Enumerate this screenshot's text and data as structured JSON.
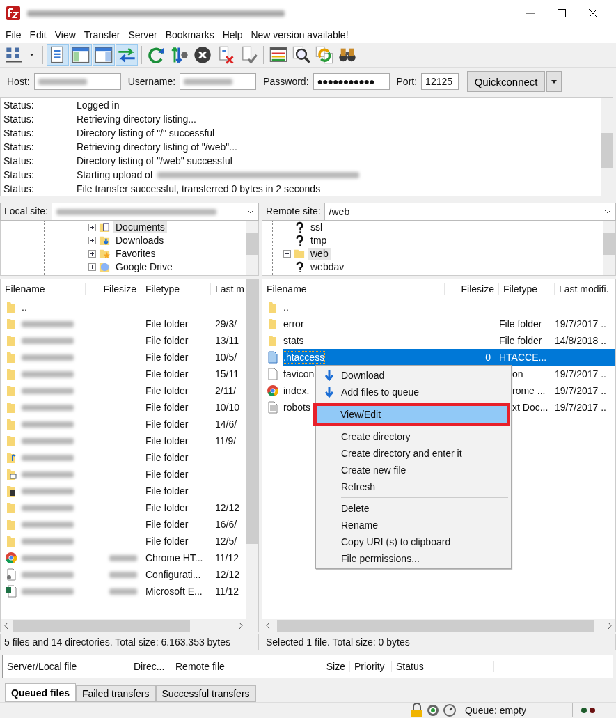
{
  "menu": [
    "File",
    "Edit",
    "View",
    "Transfer",
    "Server",
    "Bookmarks",
    "Help",
    "New version available!"
  ],
  "quickconnect": {
    "host_label": "Host:",
    "username_label": "Username:",
    "password_label": "Password:",
    "password_value": "●●●●●●●●●●●",
    "port_label": "Port:",
    "port_value": "12125",
    "button": "Quickconnect"
  },
  "log": [
    {
      "label": "Status:",
      "message": "Logged in"
    },
    {
      "label": "Status:",
      "message": "Retrieving directory listing..."
    },
    {
      "label": "Status:",
      "message": "Directory listing of \"/\" successful"
    },
    {
      "label": "Status:",
      "message": "Retrieving directory listing of \"/web\"..."
    },
    {
      "label": "Status:",
      "message": "Directory listing of \"/web\" successful"
    },
    {
      "label": "Status:",
      "message": "Starting upload of",
      "redacted": true
    },
    {
      "label": "Status:",
      "message": "File transfer successful, transferred 0 bytes in 2 seconds"
    }
  ],
  "local_site": {
    "label": "Local site:",
    "tree": [
      {
        "name": "Documents",
        "kind": "documents",
        "expandable": true,
        "selected": true
      },
      {
        "name": "Downloads",
        "kind": "downloads",
        "expandable": true,
        "selected": false
      },
      {
        "name": "Favorites",
        "kind": "favorites",
        "expandable": true,
        "selected": false
      },
      {
        "name": "Google Drive",
        "kind": "drive",
        "expandable": true,
        "selected": false
      }
    ]
  },
  "remote_site": {
    "label": "Remote site:",
    "path": "/web",
    "tree": [
      {
        "name": "ssl",
        "kind": "unknown",
        "expandable": false,
        "selected": false
      },
      {
        "name": "tmp",
        "kind": "unknown",
        "expandable": false,
        "selected": false
      },
      {
        "name": "web",
        "kind": "folder",
        "expandable": true,
        "selected": true
      },
      {
        "name": "webdav",
        "kind": "unknown",
        "expandable": false,
        "selected": false
      }
    ]
  },
  "local_list": {
    "columns": [
      "Filename",
      "Filesize",
      "Filetype",
      "Last m"
    ],
    "rows": [
      {
        "kind": "folder",
        "name": "..",
        "selected": false
      },
      {
        "kind": "folder",
        "redacted": true,
        "type": "File folder",
        "date": "29/3/",
        "selected": false
      },
      {
        "kind": "folder",
        "redacted": true,
        "type": "File folder",
        "date": "13/11",
        "selected": false
      },
      {
        "kind": "folder",
        "redacted": true,
        "type": "File folder",
        "date": "10/5/",
        "selected": false
      },
      {
        "kind": "folder",
        "redacted": true,
        "type": "File folder",
        "date": "15/11",
        "selected": false
      },
      {
        "kind": "folder",
        "redacted": true,
        "type": "File folder",
        "date": "2/11/",
        "selected": false
      },
      {
        "kind": "folder",
        "redacted": true,
        "type": "File folder",
        "date": "10/10",
        "selected": false
      },
      {
        "kind": "folder",
        "redacted": true,
        "type": "File folder",
        "date": "14/6/",
        "selected": false
      },
      {
        "kind": "folder",
        "redacted": true,
        "type": "File folder",
        "date": "11/9/",
        "selected": false
      },
      {
        "kind": "music",
        "redacted": true,
        "type": "File folder",
        "selected": false
      },
      {
        "kind": "pictures",
        "redacted": true,
        "type": "File folder",
        "selected": false
      },
      {
        "kind": "videos",
        "redacted": true,
        "type": "File folder",
        "selected": false
      },
      {
        "kind": "folder",
        "redacted": true,
        "type": "File folder",
        "date": "12/12",
        "selected": false
      },
      {
        "kind": "folder",
        "redacted": true,
        "type": "File folder",
        "date": "16/6/",
        "selected": false
      },
      {
        "kind": "folder",
        "redacted": true,
        "type": "File folder",
        "date": "12/5/",
        "selected": false
      },
      {
        "kind": "chrome",
        "redacted": true,
        "type": "Chrome HT...",
        "date": "11/12",
        "selected": false
      },
      {
        "kind": "config",
        "redacted": true,
        "type": "Configurati...",
        "date": "12/12",
        "selected": false
      },
      {
        "kind": "excel",
        "redacted": true,
        "type": "Microsoft E...",
        "date": "11/12",
        "selected": false
      }
    ]
  },
  "remote_list": {
    "columns": [
      "Filename",
      "Filesize",
      "Filetype",
      "Last modifi."
    ],
    "rows": [
      {
        "kind": "folder",
        "name": "..",
        "selected": false
      },
      {
        "kind": "folder",
        "name": "error",
        "type": "File folder",
        "date": "19/7/2017 ..",
        "selected": false
      },
      {
        "kind": "folder",
        "name": "stats",
        "type": "File folder",
        "date": "14/8/2018 ..",
        "selected": false
      },
      {
        "kind": "file-blue",
        "name": ".htaccess",
        "size": "0",
        "type": "HTACCE...",
        "selected": true
      },
      {
        "kind": "blank",
        "name": "favicon",
        "type": "on",
        "covered": true,
        "date": "19/7/2017 ..",
        "selected": false
      },
      {
        "kind": "chrome",
        "name": "index.",
        "type": "rome ...",
        "covered": true,
        "date": "19/7/2017 ..",
        "selected": false
      },
      {
        "kind": "text",
        "name": "robots",
        "type": "xt Doc...",
        "covered": true,
        "date": "19/7/2017 ..",
        "selected": false
      }
    ]
  },
  "context_menu": [
    {
      "kind": "icon-item",
      "label": "Download",
      "selected": false
    },
    {
      "kind": "icon-item",
      "label": "Add files to queue",
      "selected": false
    },
    {
      "kind": "item",
      "label": "View/Edit",
      "selected": true,
      "framed": true
    },
    {
      "kind": "item",
      "label": "Create directory",
      "selected": false
    },
    {
      "kind": "item",
      "label": "Create directory and enter it",
      "selected": false
    },
    {
      "kind": "item",
      "label": "Create new file",
      "selected": false
    },
    {
      "kind": "item",
      "label": "Refresh",
      "selected": false
    },
    {
      "kind": "separator"
    },
    {
      "kind": "item",
      "label": "Delete",
      "selected": false
    },
    {
      "kind": "item",
      "label": "Rename",
      "selected": false
    },
    {
      "kind": "item",
      "label": "Copy URL(s) to clipboard",
      "selected": false
    },
    {
      "kind": "item",
      "label": "File permissions...",
      "selected": false
    }
  ],
  "local_status": "5 files and 14 directories. Total size: 6.163.353 bytes",
  "remote_status": "Selected 1 file. Total size: 0 bytes",
  "queue": {
    "columns": [
      "Server/Local file",
      "Direc...",
      "Remote file",
      "Size",
      "Priority",
      "Status"
    ],
    "tabs": [
      {
        "label": "Queued files",
        "selected": true
      },
      {
        "label": "Failed transfers",
        "selected": false
      },
      {
        "label": "Successful transfers",
        "selected": false
      }
    ]
  },
  "status_bar": {
    "queue": "Queue: empty"
  }
}
